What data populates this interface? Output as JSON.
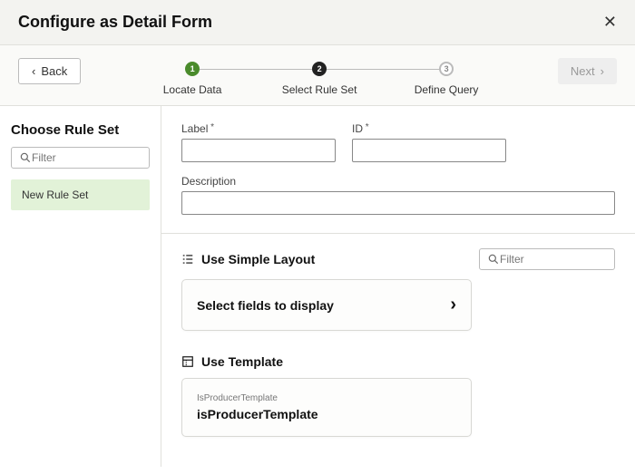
{
  "header": {
    "title": "Configure as Detail Form"
  },
  "wizard": {
    "back_label": "Back",
    "next_label": "Next",
    "steps": [
      {
        "num": "1",
        "label": "Locate Data",
        "state": "done"
      },
      {
        "num": "2",
        "label": "Select Rule Set",
        "state": "current"
      },
      {
        "num": "3",
        "label": "Define Query",
        "state": "future"
      }
    ]
  },
  "sidebar": {
    "title": "Choose Rule Set",
    "filter_placeholder": "Filter",
    "new_rule_label": "New Rule Set"
  },
  "form": {
    "label_label": "Label",
    "id_label": "ID",
    "desc_label": "Description",
    "label_value": "",
    "id_value": "",
    "desc_value": ""
  },
  "simple_layout": {
    "title": "Use Simple Layout",
    "filter_placeholder": "Filter",
    "select_fields_label": "Select fields to display"
  },
  "template": {
    "title": "Use Template",
    "card_small": "IsProducerTemplate",
    "card_name": "isProducerTemplate"
  }
}
